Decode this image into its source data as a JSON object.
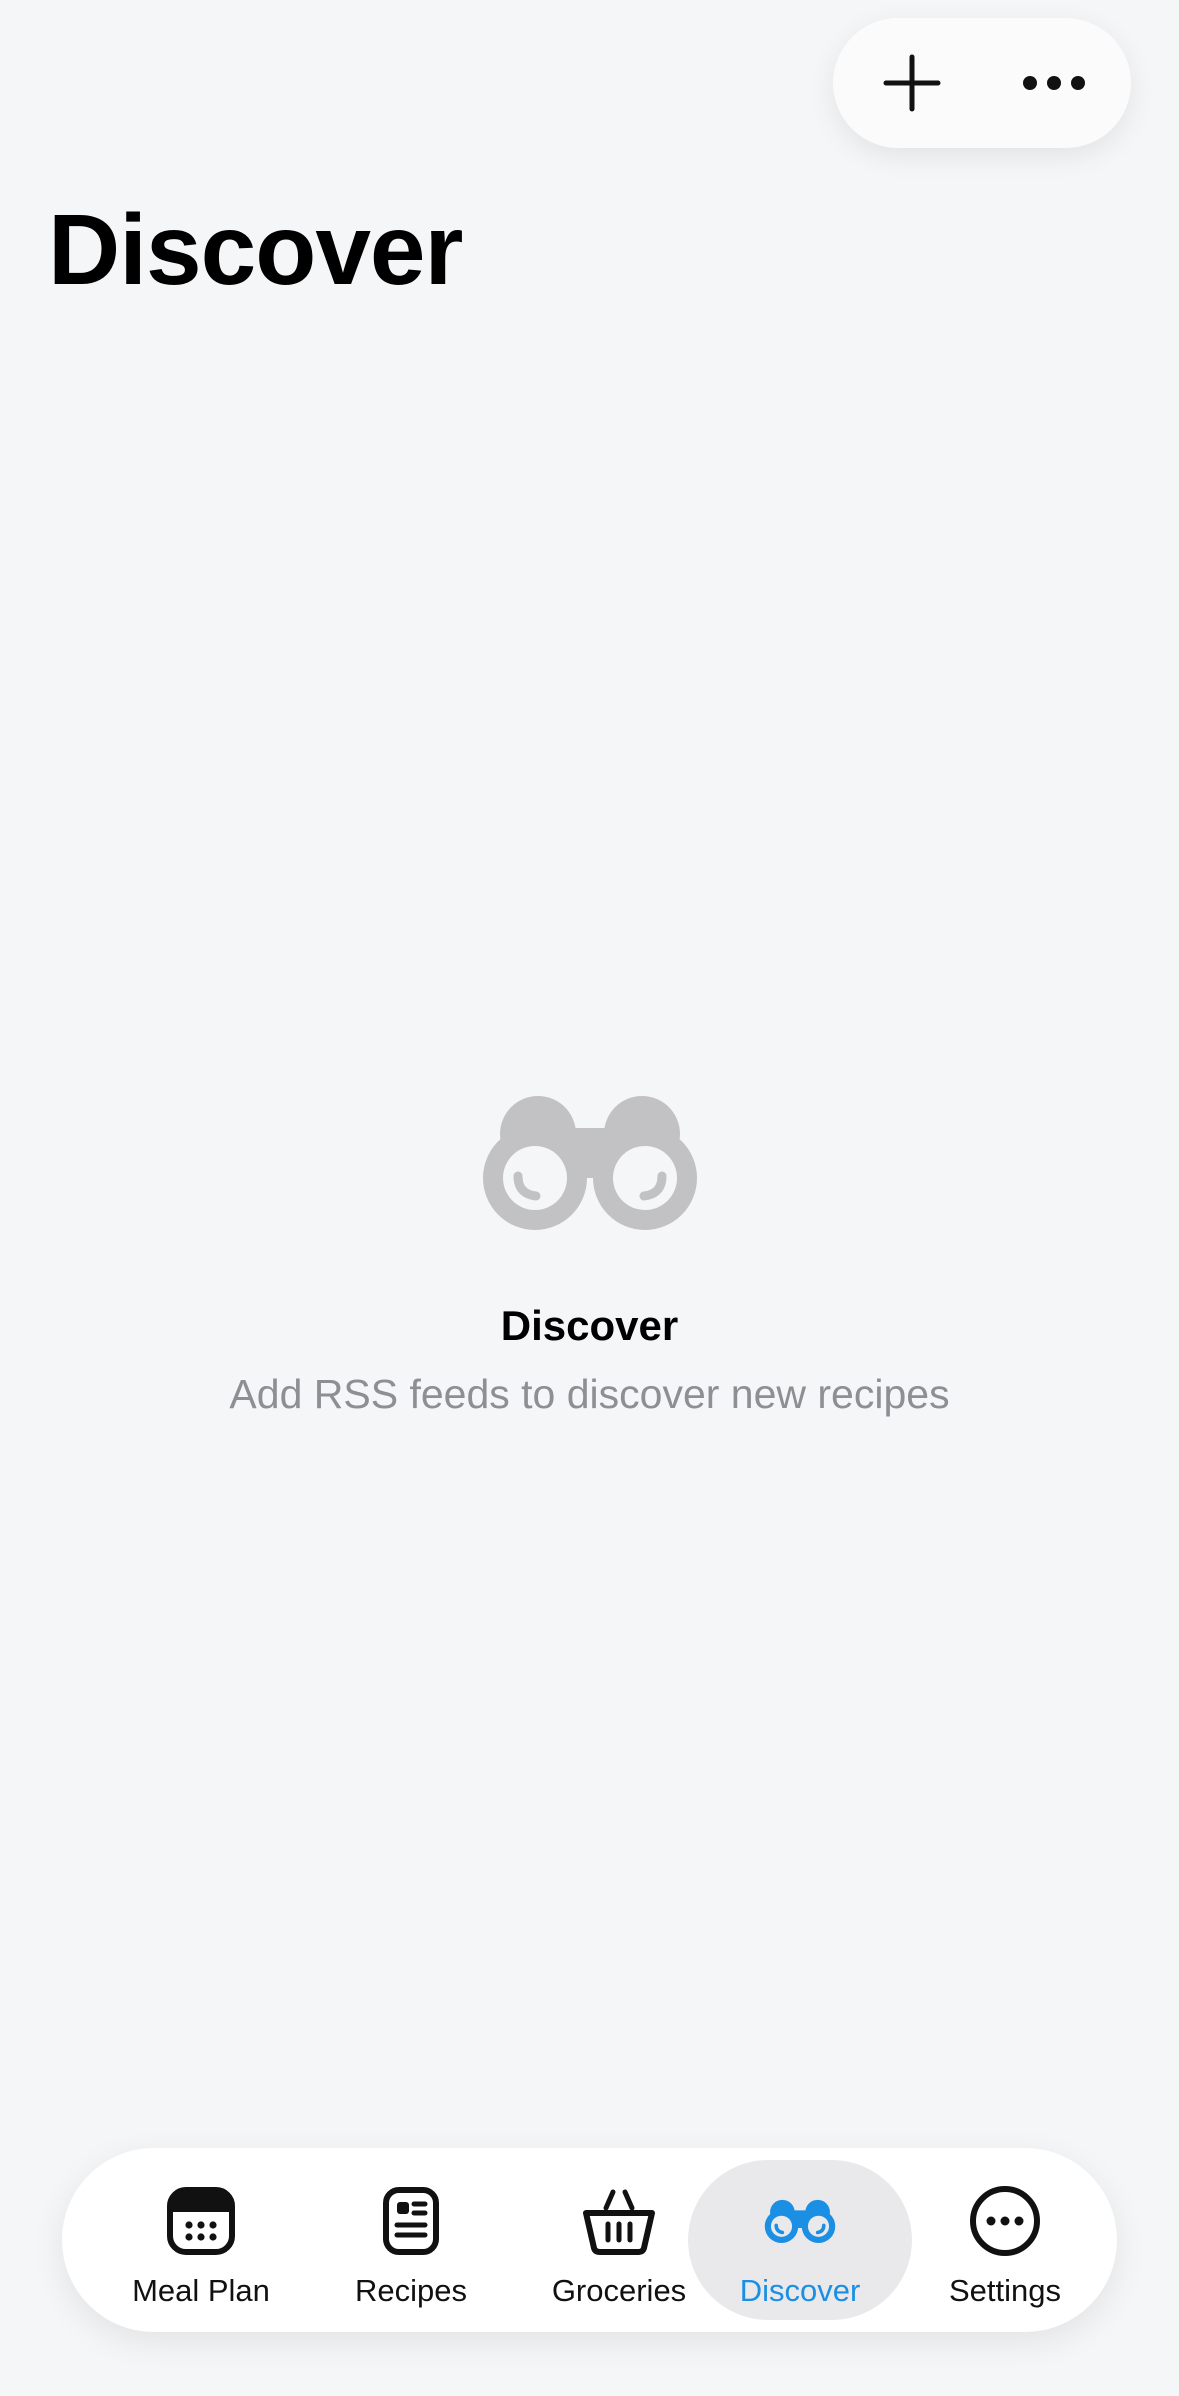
{
  "header": {
    "title": "Discover"
  },
  "top_actions": {
    "add_icon": "plus-icon",
    "more_icon": "ellipsis-icon"
  },
  "empty_state": {
    "icon": "binoculars-icon",
    "title": "Discover",
    "subtitle": "Add RSS feeds to discover new recipes"
  },
  "tab_bar": {
    "tabs": [
      {
        "label": "Meal Plan",
        "icon": "calendar-icon",
        "active": false
      },
      {
        "label": "Recipes",
        "icon": "recipe-card-icon",
        "active": false
      },
      {
        "label": "Groceries",
        "icon": "basket-icon",
        "active": false
      },
      {
        "label": "Discover",
        "icon": "binoculars-icon",
        "active": true
      },
      {
        "label": "Settings",
        "icon": "ellipsis-circle-icon",
        "active": false
      }
    ],
    "active_color": "#1a8fe3"
  }
}
